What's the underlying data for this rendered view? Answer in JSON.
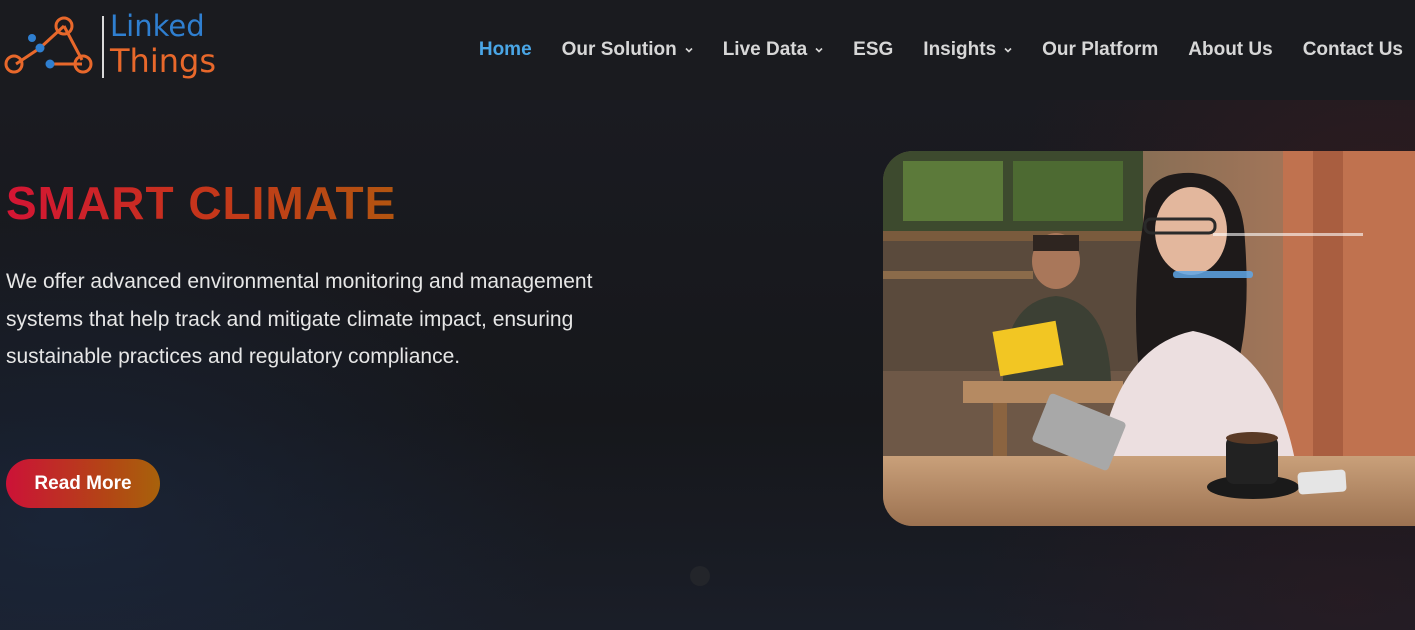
{
  "brand": {
    "logo_line1": "Linked",
    "logo_line2": "Things",
    "colors": {
      "blue": "#2f7fd0",
      "orange": "#e8682b"
    }
  },
  "nav": {
    "items": [
      {
        "label": "Home",
        "active": true,
        "dropdown": false
      },
      {
        "label": "Our Solution",
        "active": false,
        "dropdown": true
      },
      {
        "label": "Live Data",
        "active": false,
        "dropdown": true
      },
      {
        "label": "ESG",
        "active": false,
        "dropdown": false
      },
      {
        "label": "Insights",
        "active": false,
        "dropdown": true
      },
      {
        "label": "Our Platform",
        "active": false,
        "dropdown": false
      },
      {
        "label": "About Us",
        "active": false,
        "dropdown": false
      },
      {
        "label": "Contact Us",
        "active": false,
        "dropdown": false
      }
    ],
    "active_color": "#4aa6e6"
  },
  "hero": {
    "title": "SMART CLIMATE",
    "description": "We offer advanced environmental monitoring and management systems that help track and mitigate climate impact, ensuring sustainable practices and regulatory compliance.",
    "cta_label": "Read More",
    "gradient": [
      "#d41534",
      "#b25510"
    ]
  },
  "icons": {
    "logo": "network-nodes-icon",
    "dropdown": "chevron-down-icon"
  }
}
